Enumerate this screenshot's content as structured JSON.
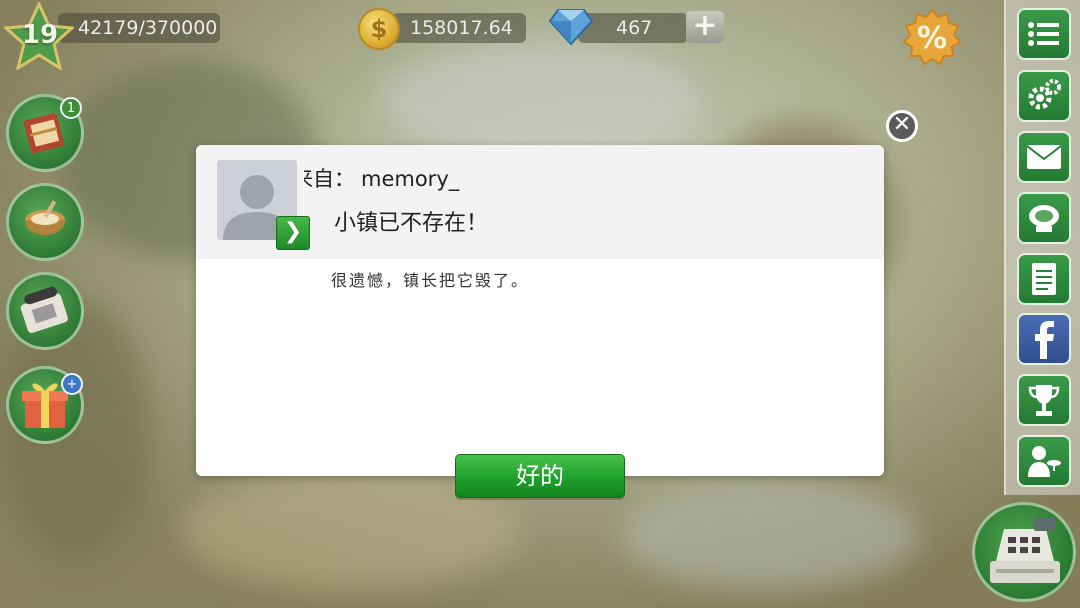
{
  "hud": {
    "level": "19",
    "xp": "42179/370000",
    "coins": "158017.64",
    "gems": "467",
    "add_label": "+",
    "sale_label": "%"
  },
  "left_buttons": {
    "journal_badge": "1",
    "gift_badge": "+"
  },
  "dialog": {
    "from_prefix": "来自：",
    "from_name": "memory_",
    "title": "小镇已不存在！",
    "message": "很遗憾，镇长把它毁了。",
    "ok_label": "好的",
    "close_label": "✕",
    "go_label": "❯"
  },
  "colors": {
    "ok_button": "#1e9d2b",
    "side_button": "#2b8a3b",
    "facebook": "#3b5998"
  }
}
